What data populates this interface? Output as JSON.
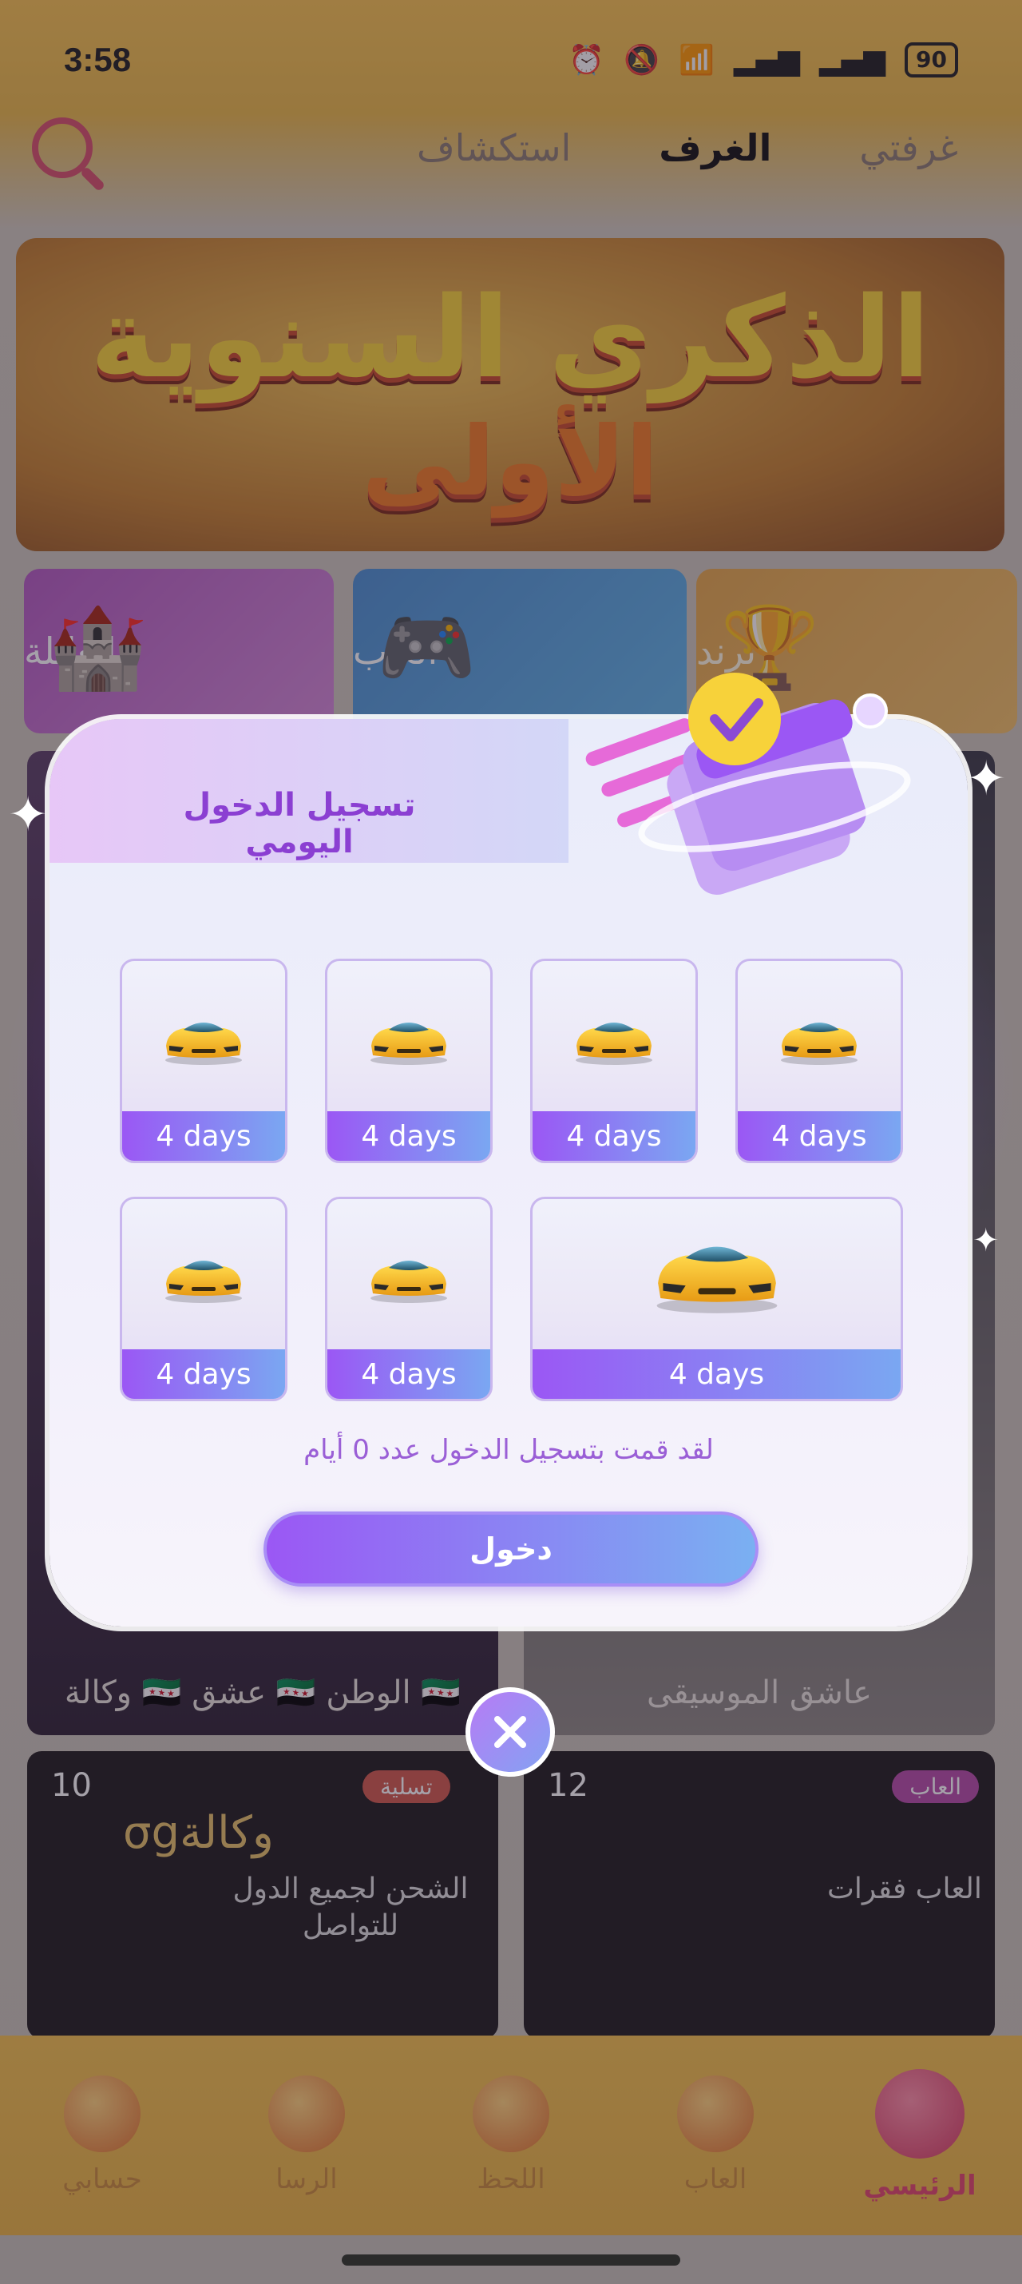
{
  "status_bar": {
    "time": "3:58",
    "battery": "90"
  },
  "top_nav": {
    "tabs": [
      "غرفتي",
      "الغرف",
      "استكشاف"
    ],
    "active_tab": "الغرف"
  },
  "banner": {
    "line1": "الذكري السنوية",
    "line2": "الأولى"
  },
  "categories": [
    {
      "label": "ترند"
    },
    {
      "label": "العاب"
    },
    {
      "label": "العائلة"
    }
  ],
  "rooms": [
    {
      "caption": "🇸🇾 الوطن 🇸🇾 عشق 🇸🇾 وكالة"
    },
    {
      "caption": "عاشق الموسيقى"
    },
    {
      "tag": "تسلية",
      "count": "10",
      "title": "وكالةσg",
      "body": "الشحن لجميع الدول للتواصل"
    },
    {
      "tag": "العاب",
      "count": "12",
      "body": "العاب فقرات"
    }
  ],
  "bottom_nav": [
    {
      "label": "الرئيسي",
      "active": true
    },
    {
      "label": "العاب",
      "active": false
    },
    {
      "label": "اللحظ",
      "active": false
    },
    {
      "label": "الرسا",
      "active": false
    },
    {
      "label": "حسابي",
      "active": false
    }
  ],
  "modal": {
    "title": "تسجيل الدخول اليومي",
    "days": [
      {
        "label": "4 days",
        "reward": "car-icon"
      },
      {
        "label": "4 days",
        "reward": "car-icon"
      },
      {
        "label": "4 days",
        "reward": "car-icon"
      },
      {
        "label": "4 days",
        "reward": "car-icon"
      },
      {
        "label": "4 days",
        "reward": "car-icon"
      },
      {
        "label": "4 days",
        "reward": "car-icon"
      },
      {
        "label": "4 days",
        "reward": "car-icon"
      }
    ],
    "note": "لقد قمت بتسجيل الدخول عدد 0 أيام",
    "button_label": "دخول",
    "close_icon": "close-icon"
  },
  "colors": {
    "accent_purple": "#9b57f4",
    "accent_blue": "#7ab0f2",
    "title_purple": "#8b3fd2",
    "nav_gold": "#f3c04d"
  }
}
